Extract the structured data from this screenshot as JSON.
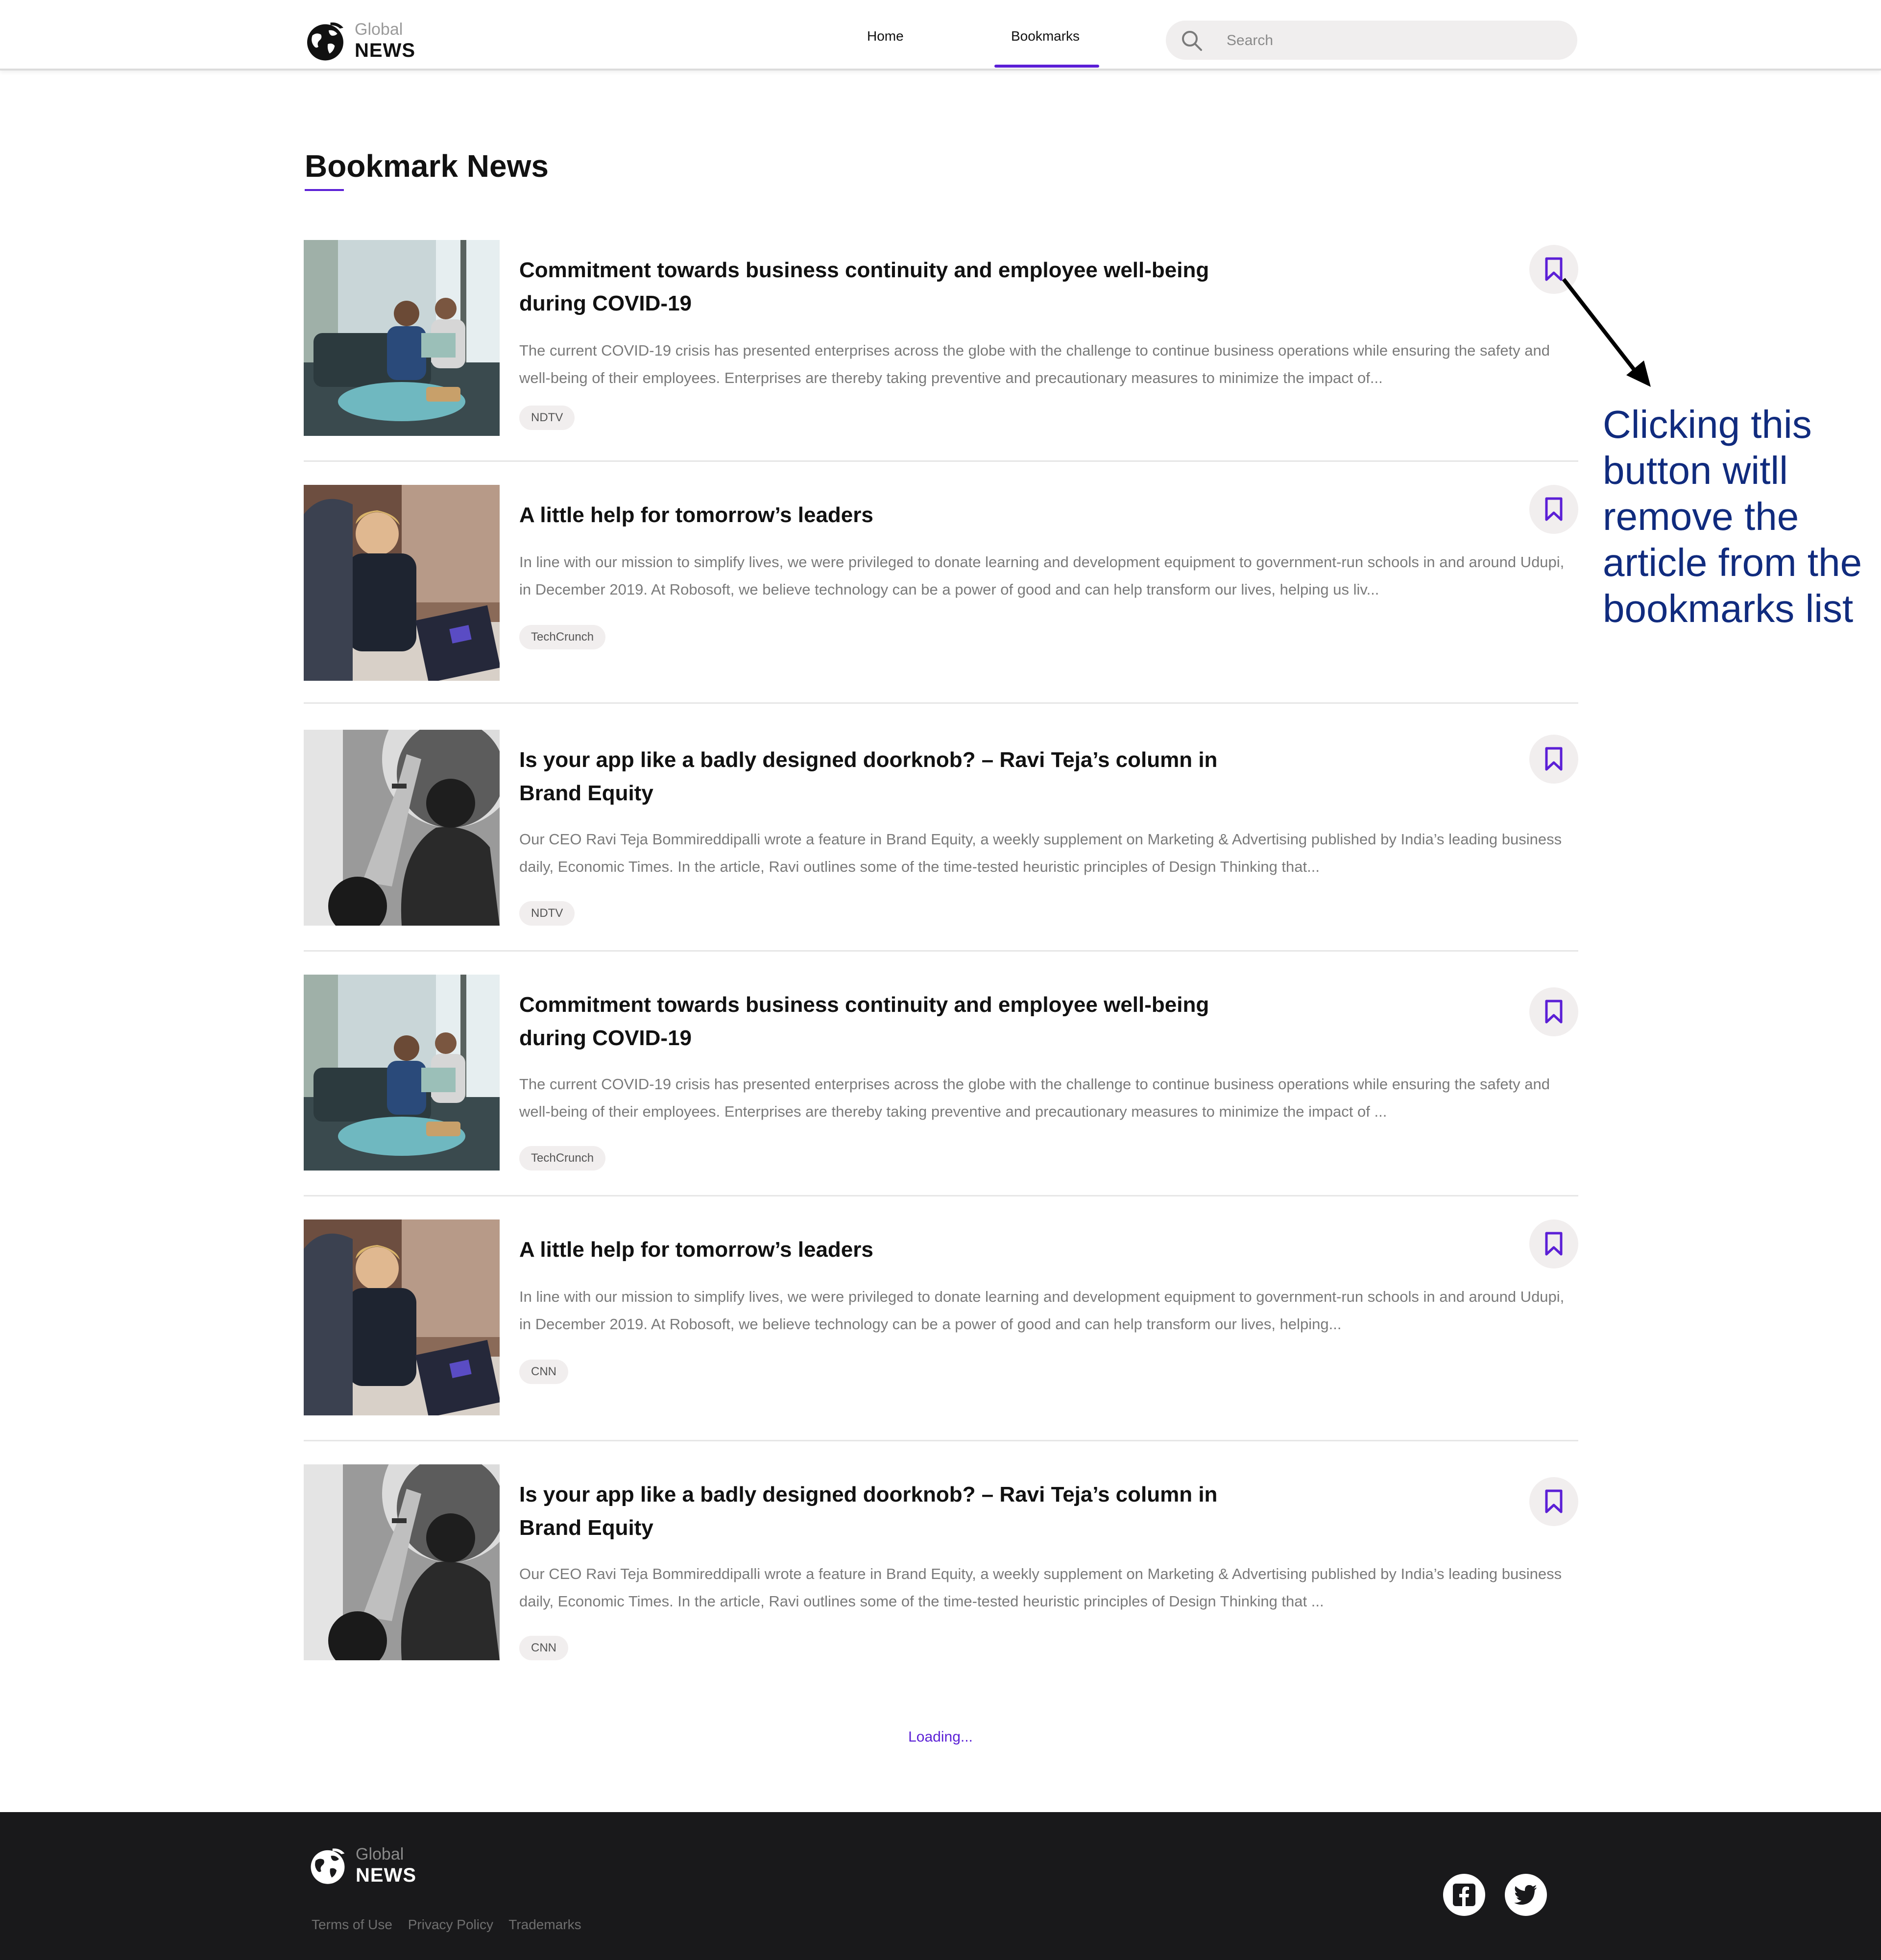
{
  "header": {
    "logo_small": "Global",
    "logo_big": "NEWS",
    "nav": [
      {
        "label": "Home"
      },
      {
        "label": "Bookmarks"
      }
    ],
    "search_placeholder": "Search"
  },
  "page": {
    "title": "Bookmark News"
  },
  "articles": [
    {
      "title": "Commitment towards business continuity and employee well-being during COVID-19",
      "description": "The current COVID-19 crisis has presented enterprises across the globe with the challenge to continue business operations while ensuring the safety and well-being of their employees. Enterprises are thereby taking preventive and precautionary measures to minimize the impact of...",
      "source": "NDTV",
      "image": "office-meeting"
    },
    {
      "title": "A little help for tomorrow’s leaders",
      "description": "In line with our mission to simplify lives, we were privileged to donate learning and development equipment to government-run schools in and around Udupi, in December 2019. At Robosoft, we believe technology can be a power of good and can help transform our lives, helping us liv...",
      "source": "TechCrunch",
      "image": "laptop-women"
    },
    {
      "title": "Is your app like a badly designed doorknob? – Ravi Teja’s column in Brand Equity",
      "description": "Our CEO Ravi Teja Bommireddipalli wrote a feature in Brand Equity, a weekly supplement on Marketing & Advertising published by India’s leading business daily, Economic Times. In the article, Ravi outlines some of the time-tested heuristic principles of Design Thinking that...",
      "source": "NDTV",
      "image": "raised-hand"
    },
    {
      "title": "Commitment towards business continuity and employee well-being during COVID-19",
      "description": "The current COVID-19 crisis has presented enterprises across the globe with the challenge to continue business operations while ensuring the safety and well-being of their employees. Enterprises are thereby taking preventive and precautionary measures to minimize the impact of ...",
      "source": "TechCrunch",
      "image": "office-meeting"
    },
    {
      "title": "A little help for tomorrow’s leaders",
      "description": "In line with our mission to simplify lives, we were privileged to donate learning and development equipment to government-run schools in and around Udupi, in December 2019. At Robosoft, we believe technology can be a power of good and can help transform our lives, helping...",
      "source": "CNN",
      "image": "laptop-women"
    },
    {
      "title": "Is your app like a badly designed doorknob? – Ravi Teja’s column in Brand Equity",
      "description": "Our CEO Ravi Teja Bommireddipalli wrote a feature in Brand Equity, a weekly supplement on Marketing & Advertising published by India’s leading business daily, Economic Times. In the article, Ravi outlines some of the time-tested heuristic principles of Design Thinking that ...",
      "source": "CNN",
      "image": "raised-hand"
    }
  ],
  "annotation": "Clicking this button witll remove the article from the bookmarks list",
  "loading": "Loading...",
  "footer": {
    "logo_small": "Global",
    "logo_big": "NEWS",
    "links": [
      "Terms of Use",
      "Privacy Policy",
      "Trademarks"
    ],
    "social": [
      "facebook-icon",
      "twitter-icon"
    ]
  },
  "colors": {
    "accent": "#5b1fd6",
    "annotation": "#102b7e",
    "footer_bg": "#19191b"
  }
}
